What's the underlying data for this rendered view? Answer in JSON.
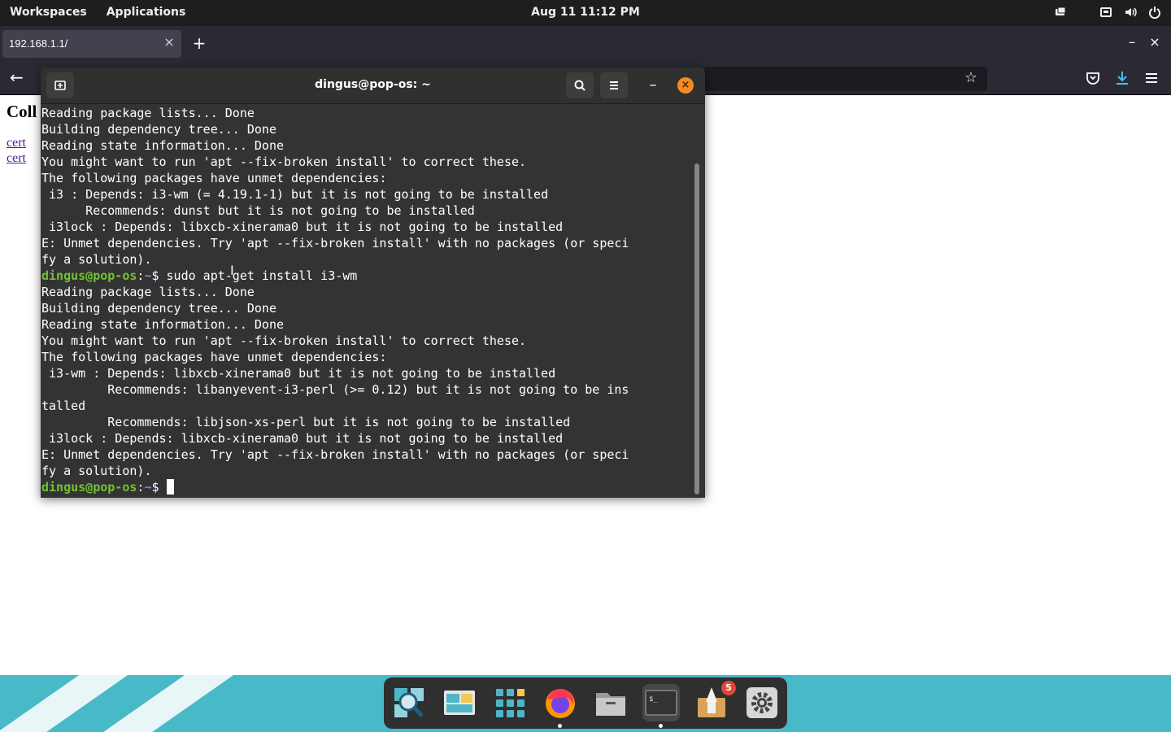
{
  "top_panel": {
    "workspaces": "Workspaces",
    "applications": "Applications",
    "clock": "Aug 11  11:12 PM",
    "tray_icons": [
      "notifications-icon",
      "network-icon",
      "volume-icon",
      "power-icon"
    ]
  },
  "browser": {
    "tab_title": "192.168.1.1/",
    "tab_close": "×",
    "new_tab": "+",
    "minimize": "–",
    "close": "×",
    "back": "←",
    "bookmark": "☆",
    "toolbar_icons": [
      "pocket-icon",
      "downloads-icon",
      "menu-icon"
    ],
    "page": {
      "heading": "Coll",
      "links": [
        "cert",
        "cert"
      ]
    }
  },
  "terminal": {
    "title": "dingus@pop-os: ~",
    "close": "×",
    "minimize": "–",
    "user": "dingus@pop-os",
    "path": "~",
    "lines": [
      {
        "text": "Reading package lists... Done"
      },
      {
        "text": "Building dependency tree... Done"
      },
      {
        "text": "Reading state information... Done"
      },
      {
        "text": "You might want to run 'apt --fix-broken install' to correct these."
      },
      {
        "text": "The following packages have unmet dependencies:"
      },
      {
        "text": " i3 : Depends: i3-wm (= 4.19.1-1) but it is not going to be installed"
      },
      {
        "text": "      Recommends: dunst but it is not going to be installed"
      },
      {
        "text": " i3lock : Depends: libxcb-xinerama0 but it is not going to be installed"
      },
      {
        "text": "E: Unmet dependencies. Try 'apt --fix-broken install' with no packages (or speci"
      },
      {
        "text": "fy a solution)."
      },
      {
        "prompt": true,
        "cmd": " sudo apt-get install i3-wm"
      },
      {
        "text": "Reading package lists... Done"
      },
      {
        "text": "Building dependency tree... Done"
      },
      {
        "text": "Reading state information... Done"
      },
      {
        "text": "You might want to run 'apt --fix-broken install' to correct these."
      },
      {
        "text": "The following packages have unmet dependencies:"
      },
      {
        "text": " i3-wm : Depends: libxcb-xinerama0 but it is not going to be installed"
      },
      {
        "text": "         Recommends: libanyevent-i3-perl (>= 0.12) but it is not going to be ins"
      },
      {
        "text": "talled"
      },
      {
        "text": "         Recommends: libjson-xs-perl but it is not going to be installed"
      },
      {
        "text": " i3lock : Depends: libxcb-xinerama0 but it is not going to be installed"
      },
      {
        "text": "E: Unmet dependencies. Try 'apt --fix-broken install' with no packages (or speci"
      },
      {
        "text": "fy a solution)."
      },
      {
        "prompt": true,
        "cmd": " ",
        "cursor": true
      }
    ]
  },
  "dock": {
    "items": [
      {
        "name": "search-icon",
        "running": false
      },
      {
        "name": "workspaces-icon",
        "running": false
      },
      {
        "name": "app-grid-icon",
        "running": false
      },
      {
        "name": "firefox-icon",
        "running": true
      },
      {
        "name": "files-icon",
        "running": false
      },
      {
        "name": "terminal-icon",
        "running": true,
        "active": true
      },
      {
        "name": "pop-shop-icon",
        "running": false
      },
      {
        "name": "settings-icon",
        "running": false
      }
    ],
    "shop_badge": "5"
  },
  "colors": {
    "panel_bg": "#1e1e1e",
    "terminal_bg": "#333333",
    "prompt_user": "#73c230",
    "prompt_path": "#5d9be0",
    "close_button": "#f58a1f",
    "wallpaper": "#48b9c7"
  }
}
